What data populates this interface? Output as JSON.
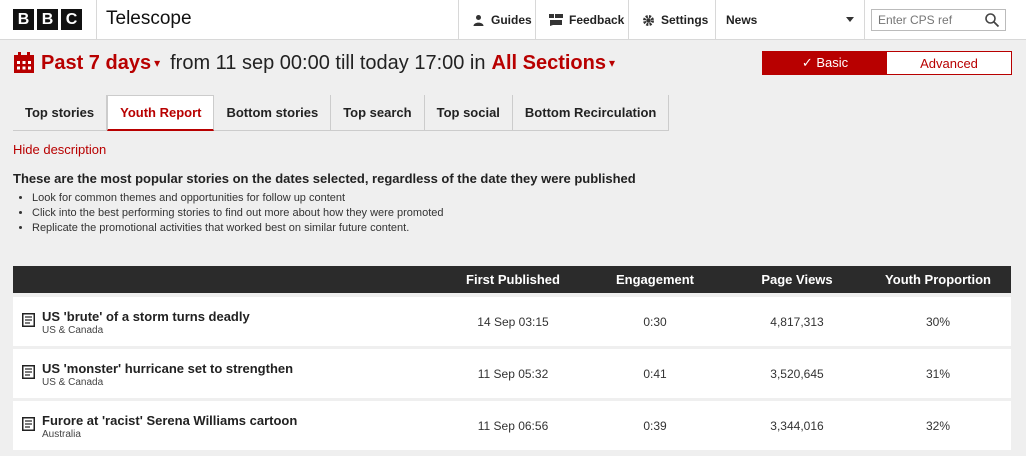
{
  "header": {
    "logo_letters": [
      "B",
      "B",
      "C"
    ],
    "app_title": "Telescope",
    "nav": [
      {
        "label": "Guides",
        "icon": "people-icon"
      },
      {
        "label": "Feedback",
        "icon": "feedback-icon"
      },
      {
        "label": "Settings",
        "icon": "gear-icon"
      }
    ],
    "news_select": "News",
    "cps_placeholder": "Enter CPS ref"
  },
  "filter": {
    "period": "Past 7 days",
    "from_text": "from 11 sep 00:00 till today 17:00 in",
    "sections": "All Sections"
  },
  "mode_toggle": {
    "basic": "✓ Basic",
    "advanced": "Advanced"
  },
  "tabs": [
    "Top stories",
    "Youth Report",
    "Bottom stories",
    "Top search",
    "Top social",
    "Bottom Recirculation"
  ],
  "active_tab": "Youth Report",
  "description": {
    "toggle_label": "Hide description",
    "title": "These are the most popular stories on the dates selected, regardless of the date they were published",
    "bullets": [
      "Look for common themes and opportunities for follow up content",
      "Click into the best performing stories to find out more about how they were promoted",
      "Replicate the promotional activities that worked best on similar future content."
    ]
  },
  "table": {
    "columns": [
      "First Published",
      "Engagement",
      "Page Views",
      "Youth Proportion"
    ],
    "rows": [
      {
        "title": "US 'brute' of a storm turns deadly",
        "section": "US & Canada",
        "published": "14 Sep 03:15",
        "engagement": "0:30",
        "views": "4,817,313",
        "youth": "30%"
      },
      {
        "title": "US 'monster' hurricane set to strengthen",
        "section": "US & Canada",
        "published": "11 Sep 05:32",
        "engagement": "0:41",
        "views": "3,520,645",
        "youth": "31%"
      },
      {
        "title": "Furore at 'racist' Serena Williams cartoon",
        "section": "Australia",
        "published": "11 Sep 06:56",
        "engagement": "0:39",
        "views": "3,344,016",
        "youth": "32%"
      }
    ]
  },
  "colors": {
    "accent": "#b80000",
    "table_header": "#2b2b2b",
    "background": "#efefef"
  }
}
